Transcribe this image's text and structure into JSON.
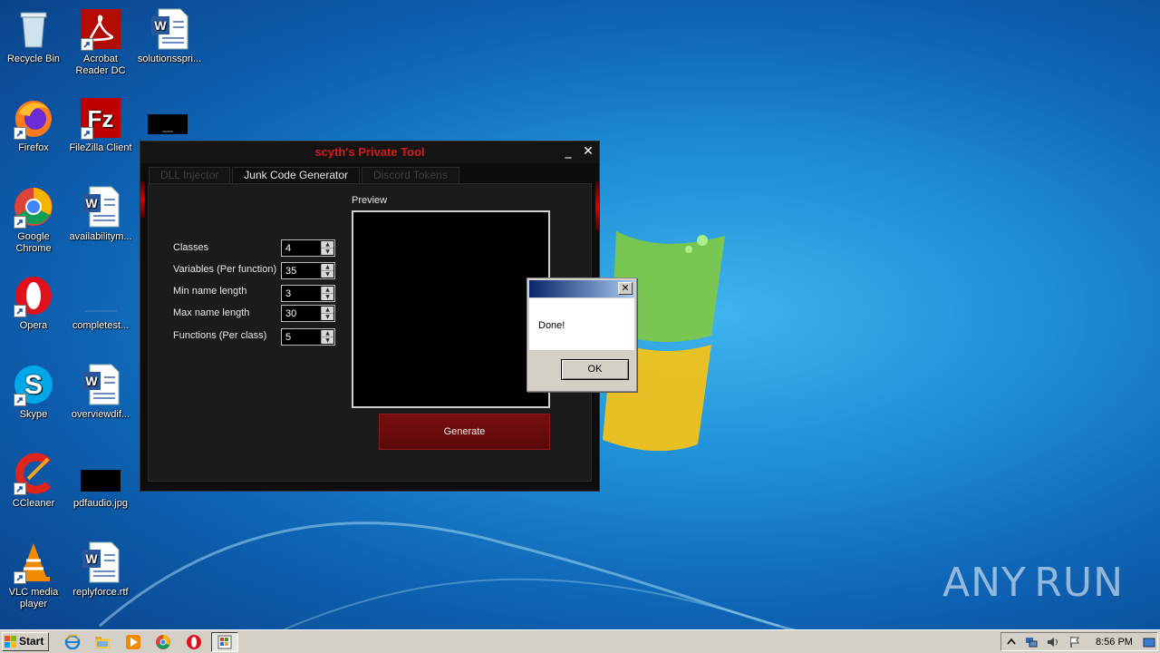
{
  "desktop": {
    "icons": [
      {
        "label": "Recycle Bin"
      },
      {
        "label": "Acrobat Reader DC"
      },
      {
        "label": "solutionsspri..."
      },
      {
        "label": "Firefox"
      },
      {
        "label": "FileZilla Client"
      },
      {
        "label": "Google Chrome"
      },
      {
        "label": "availabilitym..."
      },
      {
        "label": "Opera"
      },
      {
        "label": "completest..."
      },
      {
        "label": "Skype"
      },
      {
        "label": "overviewdif..."
      },
      {
        "label": "CCleaner"
      },
      {
        "label": "pdfaudio.jpg"
      },
      {
        "label": "VLC media player"
      },
      {
        "label": "replyforce.rtf"
      }
    ]
  },
  "tool_window": {
    "title": "scyth's Private Tool",
    "minimize_glyph": "_",
    "close_glyph": "✕",
    "tabs": [
      {
        "label": "DLL Injector",
        "active": false
      },
      {
        "label": "Junk Code Generator",
        "active": true
      },
      {
        "label": "Discord Tokens",
        "active": false
      }
    ],
    "fields": [
      {
        "label": "Classes",
        "value": "4"
      },
      {
        "label": "Variables (Per function)",
        "value": "35"
      },
      {
        "label": "Min name length",
        "value": "3"
      },
      {
        "label": "Max name length",
        "value": "30"
      },
      {
        "label": "Functions (Per class)",
        "value": "5"
      }
    ],
    "preview_label": "Preview",
    "generate_label": "Generate",
    "title_color": "#d21c1c",
    "button_color": "#6e0c0c"
  },
  "message_box": {
    "close_glyph": "✕",
    "text": "Done!",
    "ok_label": "OK"
  },
  "taskbar": {
    "start_label": "Start",
    "clock": "8:56 PM"
  },
  "watermark": {
    "left": "ANY",
    "right": "RUN"
  }
}
